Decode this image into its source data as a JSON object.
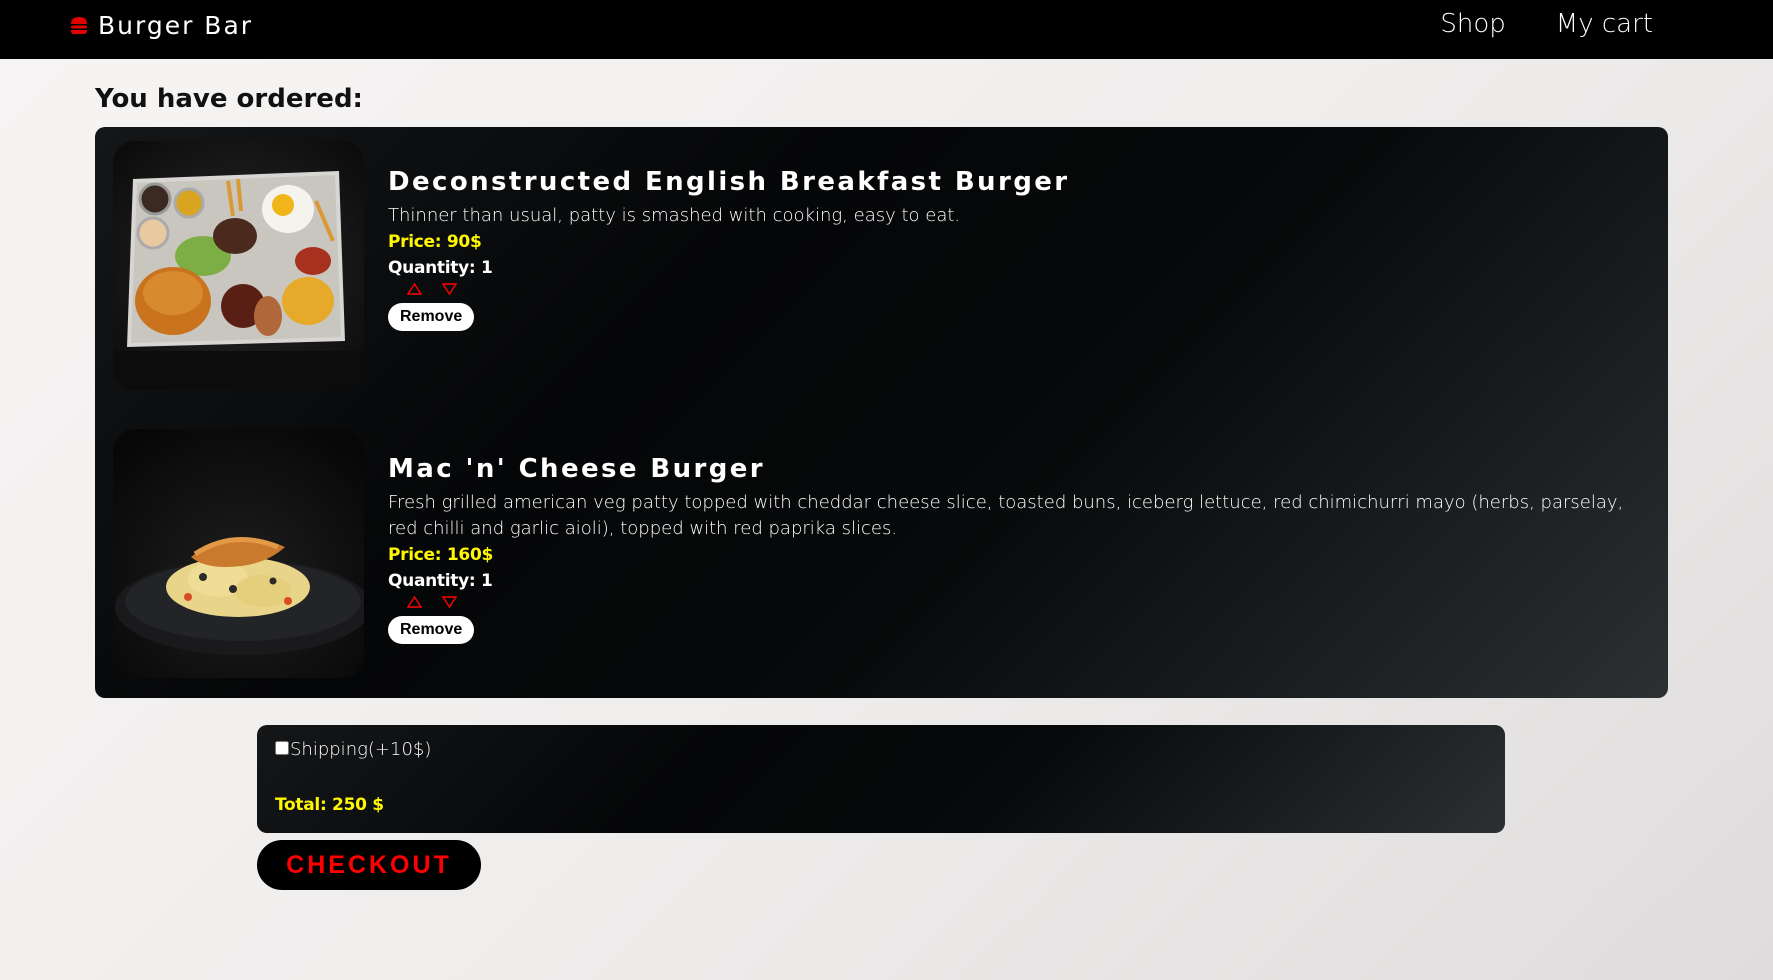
{
  "nav": {
    "brand": "Burger Bar",
    "brand_icon": "burger-icon",
    "links": [
      "Shop",
      "My cart"
    ]
  },
  "cart": {
    "heading": "You have ordered:",
    "items": [
      {
        "title": "Deconstructed English Breakfast Burger",
        "description": "Thinner than usual, patty is smashed with cooking, easy to eat.",
        "price": "Price: 90$",
        "quantity": "Quantity: 1",
        "remove_label": "Remove"
      },
      {
        "title": "Mac 'n' Cheese Burger",
        "description": "Fresh grilled american veg patty topped with cheddar cheese slice, toasted buns, iceberg lettuce, red chimichurri mayo (herbs, parselay, red chilli and garlic aioli), topped with red paprika slices.",
        "price": "Price: 160$",
        "quantity": "Quantity: 1",
        "remove_label": "Remove"
      }
    ]
  },
  "summary": {
    "shipping_label": "Shipping(+10$)",
    "shipping_checked": false,
    "total": "Total: 250 $"
  },
  "checkout_label": "CHECKOUT",
  "colors": {
    "accent_red": "#ff0000",
    "price_yellow": "#fff800",
    "nav_bg": "#000000"
  }
}
